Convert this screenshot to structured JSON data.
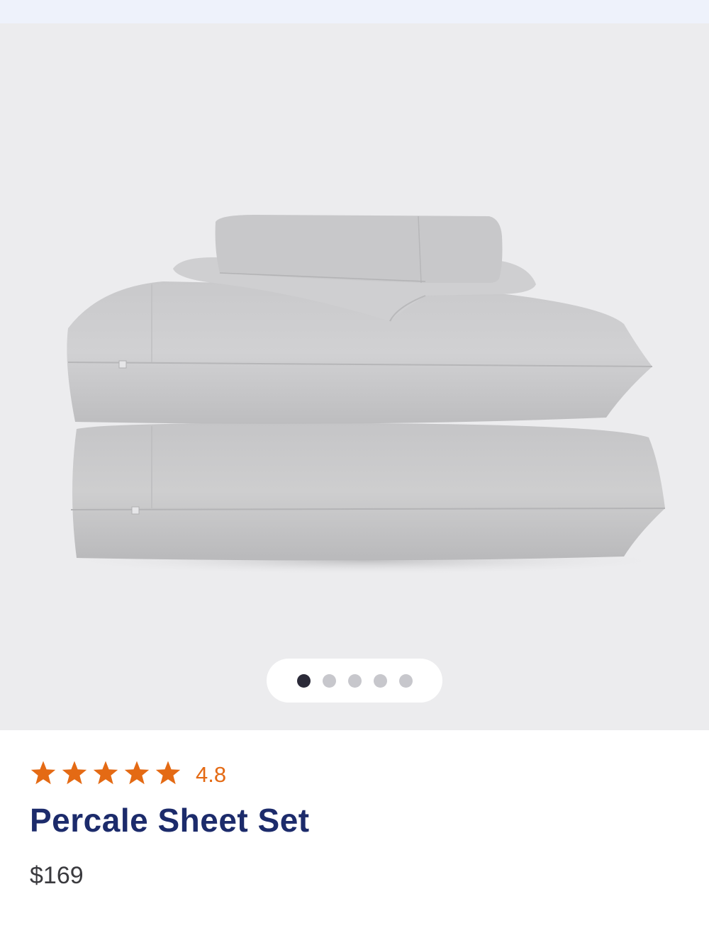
{
  "product": {
    "title": "Percale Sheet Set",
    "price": "$169",
    "rating_value": "4.8",
    "rating_stars": 5,
    "image": {
      "description_icon": "sheet-set-photo",
      "color_name": "Light Gray"
    }
  },
  "gallery": {
    "dot_count": 5,
    "active_index": 0
  },
  "colors": {
    "top_strip": "#eef2fb",
    "gallery_bg": "#ececee",
    "star": "#e46a14",
    "title": "#1c2b6b",
    "price": "#3a3a3e",
    "dot_active": "#2b2a38",
    "dot_inactive": "#c7c7cc"
  }
}
